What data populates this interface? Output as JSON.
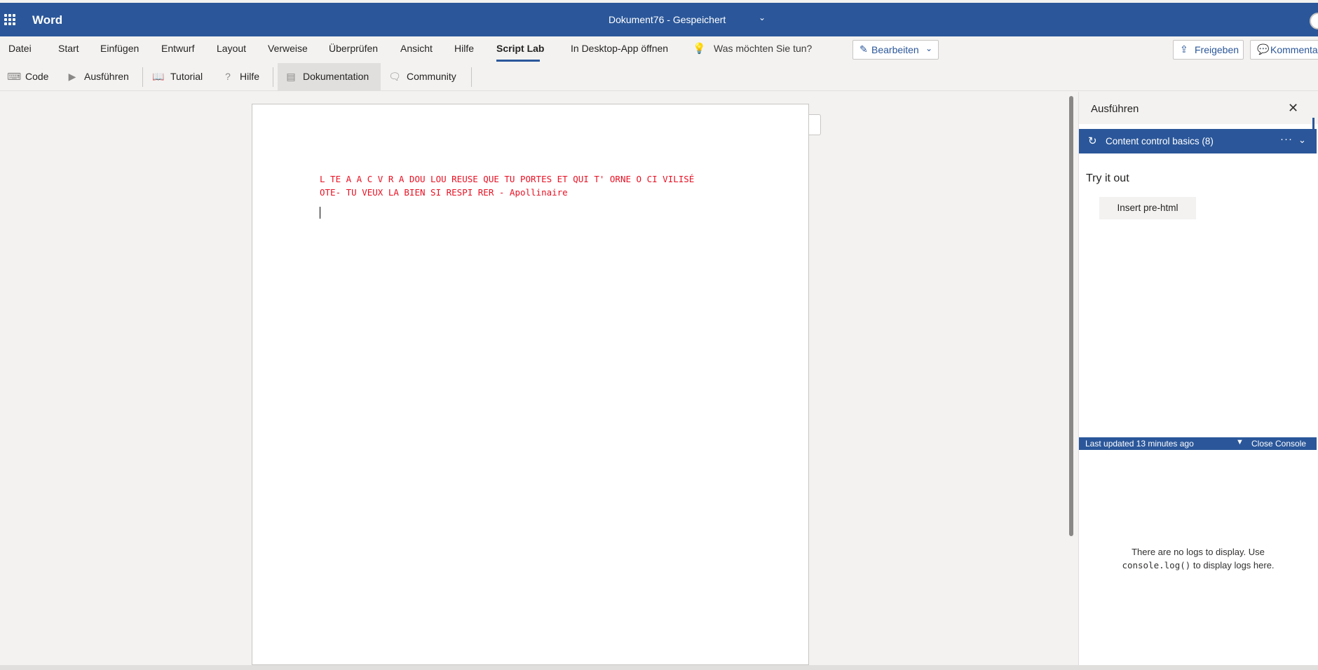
{
  "header": {
    "app_name": "Word",
    "doc_title": "Dokument76  -  Gespeichert"
  },
  "menu": {
    "items": [
      {
        "label": "Datei"
      },
      {
        "label": "Start"
      },
      {
        "label": "Einfügen"
      },
      {
        "label": "Entwurf"
      },
      {
        "label": "Layout"
      },
      {
        "label": "Verweise"
      },
      {
        "label": "Überprüfen"
      },
      {
        "label": "Ansicht"
      },
      {
        "label": "Hilfe"
      },
      {
        "label": "Script Lab"
      }
    ],
    "active": "Script Lab",
    "desktop_app": "In Desktop-App öffnen",
    "search_placeholder": "Was möchten Sie tun?",
    "edit_mode": "Bearbeiten",
    "share": "Freigeben",
    "comments": "Kommentare"
  },
  "toolbar": {
    "code": "Code",
    "run": "Ausführen",
    "tutorial": "Tutorial",
    "help": "Hilfe",
    "docs": "Dokumentation",
    "community": "Community"
  },
  "document": {
    "line1": "L TE A A C V R A DOU LOU REUSE QUE TU PORTES ET QUI T' ORNE O CI VILISÉ",
    "line2": "OTE- TU VEUX LA BIEN SI RESPI RER - Apollinaire",
    "text_color": "#e81123"
  },
  "pane": {
    "title": "Ausführen",
    "snippet_name": "Content control basics (8)",
    "section_title": "Try it out",
    "insert_button": "Insert pre-html",
    "console_updated": "Last updated 13 minutes ago",
    "console_close": "Close Console",
    "no_logs_prefix": "There are no logs to display. Use",
    "no_logs_code": "console.log()",
    "no_logs_suffix": "to display logs here."
  },
  "colors": {
    "brand": "#2b579a"
  }
}
